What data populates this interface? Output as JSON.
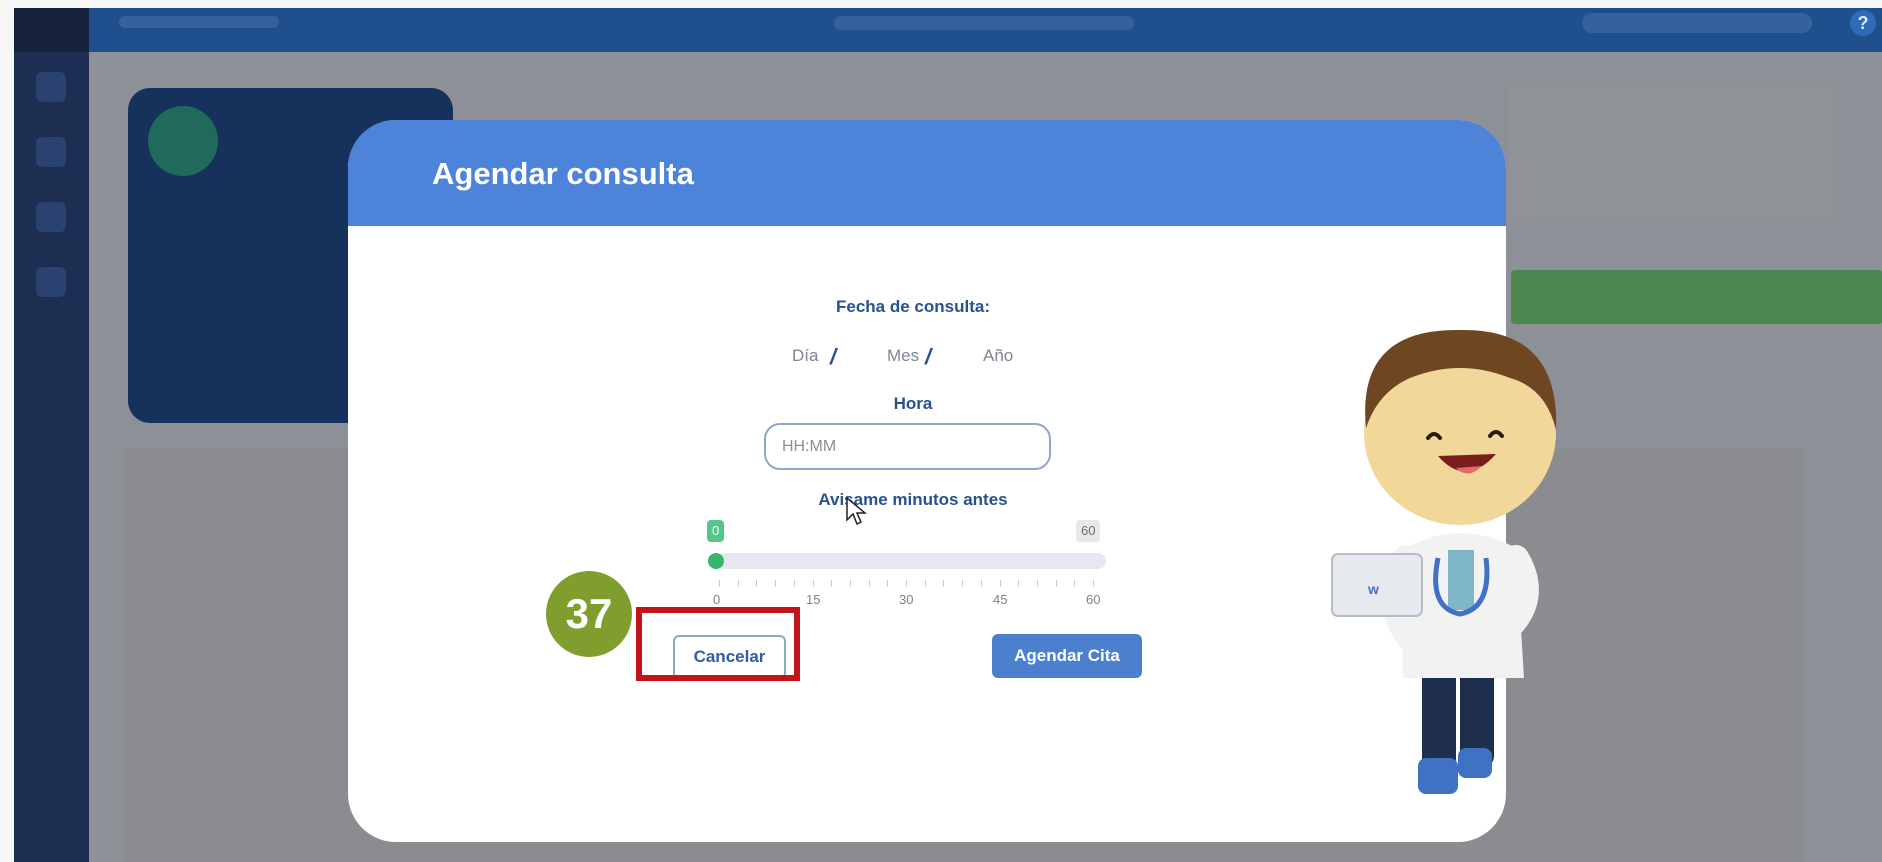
{
  "modal": {
    "title": "Agendar consulta",
    "fecha_label": "Fecha de consulta:",
    "date_parts": {
      "day": "Día",
      "month": "Mes",
      "year": "Año",
      "separator": "/"
    },
    "hora_label": "Hora",
    "time_placeholder": "HH:MM",
    "reminder_label": "Avisame minutos antes",
    "slider": {
      "min": 0,
      "max": 60,
      "value": 0,
      "min_bubble": "0",
      "max_bubble": "60",
      "tick_labels": [
        "0",
        "15",
        "30",
        "45",
        "60"
      ]
    },
    "cancel_label": "Cancelar",
    "submit_label": "Agendar Cita"
  },
  "annotation": {
    "step_number": "37",
    "highlight_color": "#c4141b"
  },
  "colors": {
    "header": "#4d83d9",
    "primary_button": "#4c7fce",
    "label_text": "#28518f",
    "slider_active": "#38b56d"
  },
  "icons": [
    "help-icon",
    "mouse-pointer-icon",
    "doctor-mascot-icon"
  ]
}
